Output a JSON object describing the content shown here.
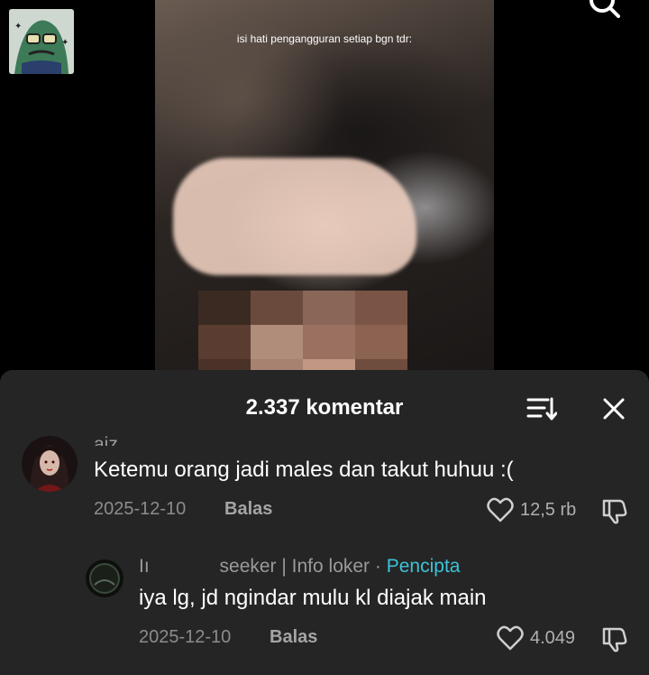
{
  "video": {
    "caption": "isi hati pengangguran setiap bgn tdr:"
  },
  "comments_sheet": {
    "title": "2.337 komentar",
    "comments": [
      {
        "username": "aiz",
        "text": "Ketemu orang jadi males dan takut huhuu :(",
        "date": "2025-12-10",
        "reply_label": "Balas",
        "likes": "12,5 rb"
      },
      {
        "username_start": "Iı",
        "username_end": "seeker | Info loker",
        "separator": "·",
        "badge": "Pencipta",
        "text": "iya lg, jd ngindar mulu kl diajak main",
        "date": "2025-12-10",
        "reply_label": "Balas",
        "likes": "4.049"
      }
    ]
  },
  "colors": {
    "sheet_bg": "#252525",
    "creator_badge": "#3cc3d8",
    "text_muted": "#8c8c8c"
  },
  "icons": {
    "top_right": "search-icon",
    "sort": "sort-icon",
    "close": "close-icon",
    "like": "heart-icon",
    "dislike": "dislike-icon"
  }
}
